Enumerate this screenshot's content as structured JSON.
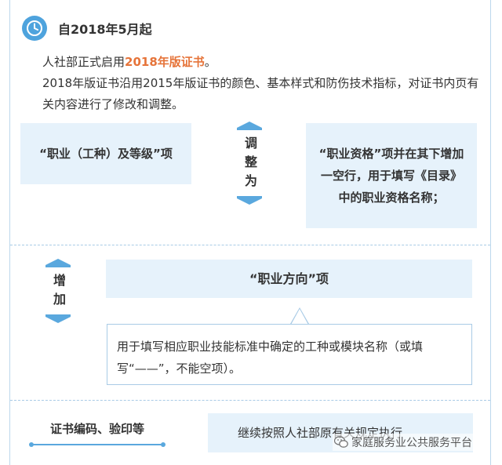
{
  "header": {
    "title": "自2018年5月起",
    "icon": "clock-icon"
  },
  "intro": {
    "line1_prefix": "人社部正式启用",
    "line1_highlight": "2018年版证书",
    "line1_suffix": "。",
    "line2": "2018年版证书沿用2015年版证书的颜色、基本样式和防伤技术指标，对证书内页有关内容进行了修改和调整。"
  },
  "adjust": {
    "from": "“职业（工种）及等级”项",
    "label": "调整为",
    "to": "“职业资格”项并在其下增加一空行，用于填写《目录》中的职业资格名称；"
  },
  "add": {
    "label": "增加",
    "item": "“职业方向”项",
    "note": "用于填写相应职业技能标准中确定的工种或模块名称（或填写“——”，不能空项）。"
  },
  "cert": {
    "label": "证书编码、验印等",
    "text": "继续按照人社部原有关规定执行"
  },
  "watermark": {
    "text": "家庭服务业公共服务平台",
    "icon": "wechat-icon"
  },
  "colors": {
    "accent": "#4ea3dd",
    "highlight": "#e6743a",
    "box_fill": "#e6f2fb",
    "border": "#a9cbe6"
  }
}
